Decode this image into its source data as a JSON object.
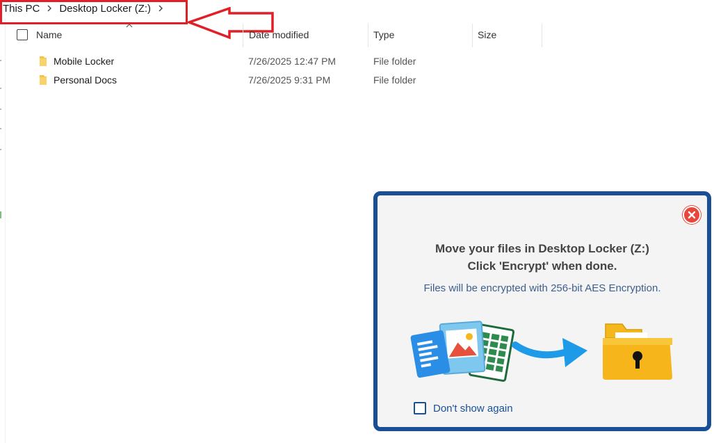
{
  "breadcrumb": {
    "items": [
      "This PC",
      "Desktop Locker (Z:)"
    ]
  },
  "columns": {
    "name": "Name",
    "date_modified": "Date modified",
    "type": "Type",
    "size": "Size"
  },
  "files": [
    {
      "name": "Mobile Locker",
      "date": "7/26/2025 12:47 PM",
      "type": "File folder"
    },
    {
      "name": "Personal Docs",
      "date": "7/26/2025 9:31 PM",
      "type": "File folder"
    }
  ],
  "popup": {
    "title_line1": "Move your files in Desktop Locker (Z:)",
    "title_line2": "Click 'Encrypt' when done.",
    "subtitle": "Files will be encrypted with 256-bit AES Encryption.",
    "dont_show": "Don't show again"
  },
  "colors": {
    "annotation_red": "#e01f26",
    "popup_border": "#1a4f96",
    "folder_yellow": "#f5b81c",
    "close_red": "#e8453c"
  }
}
